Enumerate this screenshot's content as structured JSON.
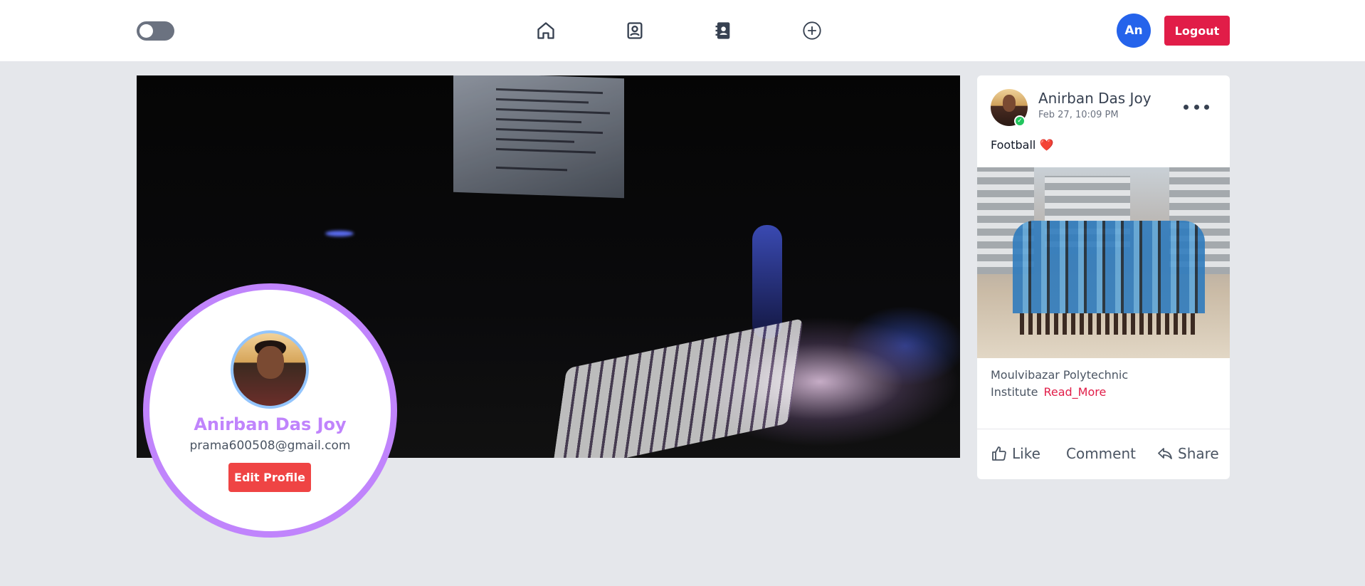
{
  "navbar": {
    "theme_toggle": "off",
    "icons": [
      "home-icon",
      "profile-card-icon",
      "contacts-book-icon",
      "add-circle-icon"
    ],
    "avatar_initials": "An",
    "logout_label": "Logout",
    "colors": {
      "avatar": "#2563eb",
      "logout": "#e11d48"
    }
  },
  "profile": {
    "name": "Anirban Das Joy",
    "email": "prama600508@gmail.com",
    "edit_label": "Edit Profile",
    "colors": {
      "ring": "#c084fc",
      "edit": "#ef4444"
    }
  },
  "post": {
    "author": "Anirban Das Joy",
    "timestamp": "Feb 27, 10:09 PM",
    "text": "Football",
    "emoji": "❤️",
    "description": "Moulvibazar Polytechnic Institute",
    "read_more": "Read_More",
    "actions": {
      "like": "Like",
      "comment": "Comment",
      "share": "Share"
    }
  }
}
